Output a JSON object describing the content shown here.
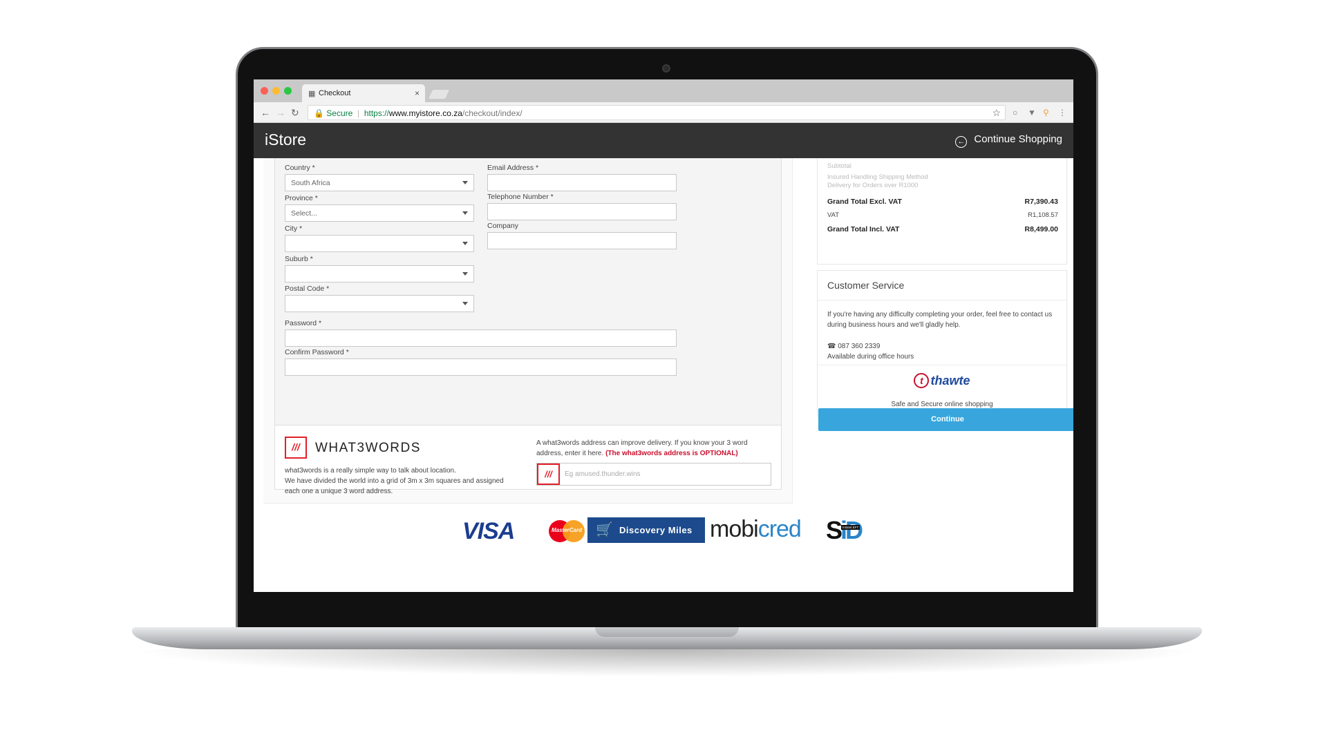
{
  "browser": {
    "tab_title": "Checkout",
    "tab_close": "×",
    "secure_label": "Secure",
    "url_prefix": "https://",
    "url_host": "www.myistore.co.za",
    "url_path": "/checkout/index/"
  },
  "header": {
    "logo": "iStore",
    "continue_shopping": "Continue Shopping"
  },
  "form": {
    "country_label": "Country *",
    "country_value": "South Africa",
    "province_label": "Province *",
    "province_value": "Select...",
    "city_label": "City *",
    "suburb_label": "Suburb *",
    "postal_label": "Postal Code *",
    "email_label": "Email Address *",
    "phone_label": "Telephone Number *",
    "company_label": "Company",
    "password_label": "Password *",
    "confirm_password_label": "Confirm Password *"
  },
  "w3w": {
    "logo_mark": "///",
    "wordmark": "WHAT3WORDS",
    "desc_line1": "what3words is a really simple way to talk about location.",
    "desc_line2": "We have divided the world into a grid of 3m x 3m squares and assigned each one a unique 3 word address.",
    "info": "A what3words address can improve delivery. If you know your 3 word address, enter it here.",
    "optional": "(The what3words address is OPTIONAL)",
    "placeholder": "Eg amused.thunder.wins"
  },
  "summary": {
    "faded_line1": "Subtotal",
    "faded_line2": "Insured Handling Shipping Method",
    "faded_line3": "Delivery for Orders over R1000",
    "grand_excl_label": "Grand Total Excl. VAT",
    "grand_excl_value": "R7,390.43",
    "vat_label": "VAT",
    "vat_value": "R1,108.57",
    "grand_incl_label": "Grand Total Incl. VAT",
    "grand_incl_value": "R8,499.00"
  },
  "customer_service": {
    "title": "Customer Service",
    "text": "If you're having any difficulty completing your order, feel free to contact us during business hours and we'll gladly help.",
    "phone": "087 360 2339",
    "hours": "Available during office hours",
    "thawte_mark": "t",
    "thawte_word": "thawte",
    "thawte_sub": "Safe and Secure online shopping"
  },
  "actions": {
    "continue_label": "Continue"
  },
  "payments": {
    "visa": "VISA",
    "mastercard": "MasterCard",
    "discovery": "Discovery Miles",
    "mobicred_a": "mobi",
    "mobicred_b": "cred",
    "sid_s": "S",
    "sid_d": "iD",
    "sid_badge": "Instant EFT"
  },
  "colors": {
    "header_bg": "#333333",
    "continue_button": "#38a6dc",
    "w3w_red": "#e11f26",
    "optional_red": "#c8102e"
  }
}
